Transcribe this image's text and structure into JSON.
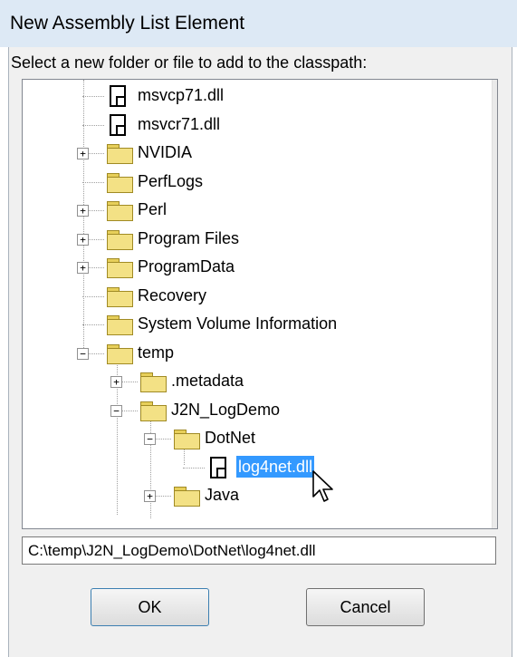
{
  "window": {
    "title": "New Assembly List Element"
  },
  "prompt": "Select a new folder or file to add to the classpath:",
  "tree": {
    "items": [
      {
        "label": "msvcp71.dll",
        "type": "file",
        "level": 1,
        "expander": "",
        "selected": false
      },
      {
        "label": "msvcr71.dll",
        "type": "file",
        "level": 1,
        "expander": "",
        "selected": false
      },
      {
        "label": "NVIDIA",
        "type": "folder",
        "level": 1,
        "expander": "+",
        "selected": false
      },
      {
        "label": "PerfLogs",
        "type": "folder",
        "level": 1,
        "expander": "",
        "selected": false
      },
      {
        "label": "Perl",
        "type": "folder",
        "level": 1,
        "expander": "+",
        "selected": false
      },
      {
        "label": "Program Files",
        "type": "folder",
        "level": 1,
        "expander": "+",
        "selected": false
      },
      {
        "label": "ProgramData",
        "type": "folder",
        "level": 1,
        "expander": "+",
        "selected": false
      },
      {
        "label": "Recovery",
        "type": "folder",
        "level": 1,
        "expander": "",
        "selected": false
      },
      {
        "label": "System Volume Information",
        "type": "folder",
        "level": 1,
        "expander": "",
        "selected": false
      },
      {
        "label": "temp",
        "type": "folder",
        "level": 1,
        "expander": "−",
        "selected": false
      },
      {
        "label": ".metadata",
        "type": "folder",
        "level": 2,
        "expander": "+",
        "selected": false
      },
      {
        "label": "J2N_LogDemo",
        "type": "folder",
        "level": 2,
        "expander": "−",
        "selected": false
      },
      {
        "label": "DotNet",
        "type": "folder",
        "level": 3,
        "expander": "−",
        "selected": false
      },
      {
        "label": "log4net.dll",
        "type": "file",
        "level": 4,
        "expander": "",
        "selected": true
      },
      {
        "label": "Java",
        "type": "folder",
        "level": 3,
        "expander": "+",
        "selected": false
      }
    ]
  },
  "scrollbar": {
    "up_icon": "▲",
    "down_icon": "▼"
  },
  "path_field": {
    "value": "C:\\temp\\J2N_LogDemo\\DotNet\\log4net.dll"
  },
  "buttons": {
    "ok": "OK",
    "cancel": "Cancel"
  }
}
